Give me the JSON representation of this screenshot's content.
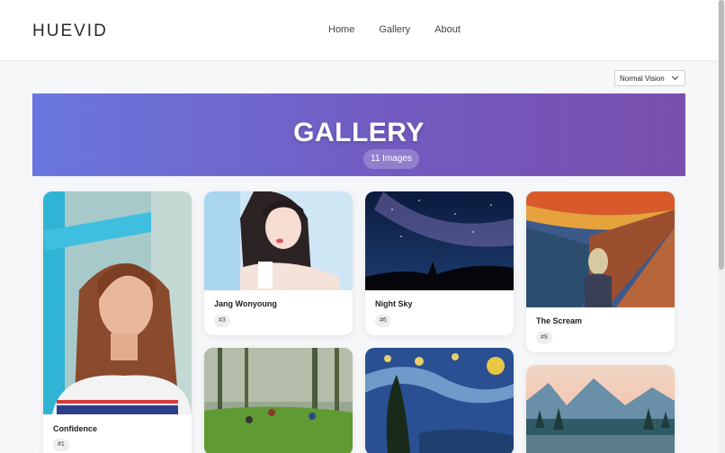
{
  "brand": {
    "logo": "HUEVID"
  },
  "nav": {
    "items": [
      "Home",
      "Gallery",
      "About"
    ]
  },
  "vision": {
    "selected": "Normal Vision"
  },
  "banner": {
    "title": "GALLERY",
    "count": "11 Images"
  },
  "cards": [
    {
      "title": "Confidence",
      "tag": "#1"
    },
    {
      "title": "Jang Wonyoung",
      "tag": "#3"
    },
    {
      "title": "Night Sky",
      "tag": "#6"
    },
    {
      "title": "The Scream",
      "tag": "#9"
    }
  ]
}
